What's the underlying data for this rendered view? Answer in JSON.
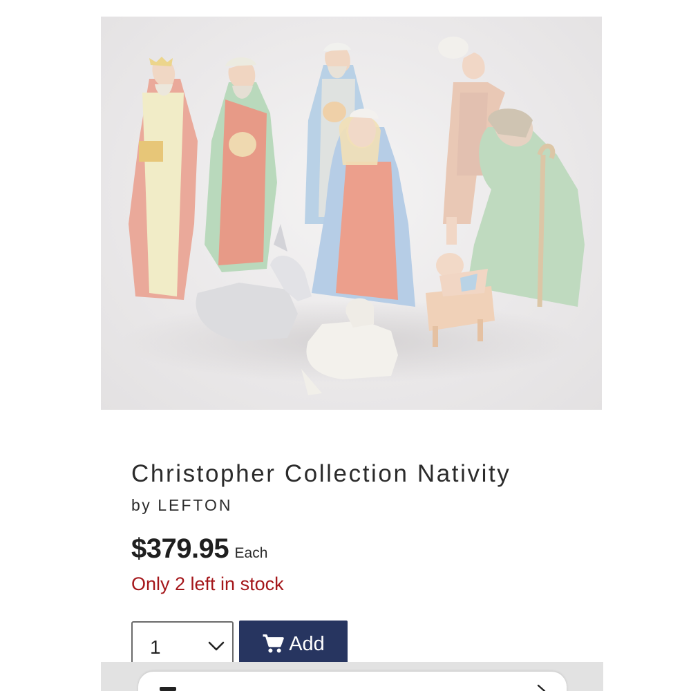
{
  "product": {
    "image_alt": "Christopher Collection Nativity figurines",
    "title": "Christopher Collection Nativity",
    "by_label": "by",
    "brand": "LEFTON",
    "price": "$379.95",
    "unit": "Each",
    "stock_message": "Only 2 left in stock"
  },
  "purchase": {
    "quantity": "1",
    "add_label": "Add"
  },
  "colors": {
    "stock_red": "#a4161a",
    "button_navy": "#273560",
    "text": "#2b2b2b"
  },
  "icons": [
    "chevron-down-icon",
    "cart-icon"
  ]
}
